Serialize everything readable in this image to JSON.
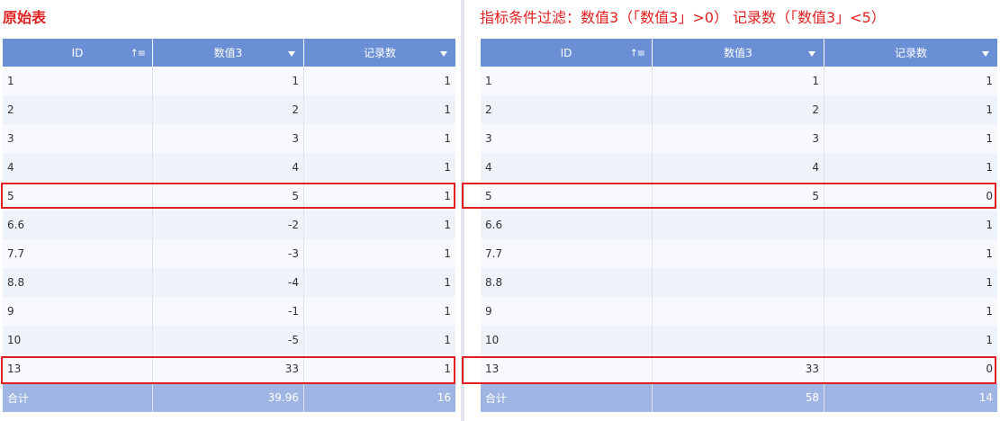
{
  "left": {
    "title": "原始表",
    "headers": [
      "ID",
      "数值3",
      "记录数"
    ],
    "rows": [
      [
        "1",
        "1",
        "1"
      ],
      [
        "2",
        "2",
        "1"
      ],
      [
        "3",
        "3",
        "1"
      ],
      [
        "4",
        "4",
        "1"
      ],
      [
        "5",
        "5",
        "1"
      ],
      [
        "6.6",
        "-2",
        "1"
      ],
      [
        "7.7",
        "-3",
        "1"
      ],
      [
        "8.8",
        "-4",
        "1"
      ],
      [
        "9",
        "-1",
        "1"
      ],
      [
        "10",
        "-5",
        "1"
      ],
      [
        "13",
        "33",
        "1"
      ]
    ],
    "total": [
      "合计",
      "39.96",
      "16"
    ]
  },
  "right": {
    "title": "指标条件过滤：数值3（「数值3」>0） 记录数（「数值3」<5）",
    "headers": [
      "ID",
      "数值3",
      "记录数"
    ],
    "rows": [
      [
        "1",
        "1",
        "1"
      ],
      [
        "2",
        "2",
        "1"
      ],
      [
        "3",
        "3",
        "1"
      ],
      [
        "4",
        "4",
        "1"
      ],
      [
        "5",
        "5",
        "0"
      ],
      [
        "6.6",
        "",
        "1"
      ],
      [
        "7.7",
        "",
        "1"
      ],
      [
        "8.8",
        "",
        "1"
      ],
      [
        "9",
        "",
        "1"
      ],
      [
        "10",
        "",
        "1"
      ],
      [
        "13",
        "33",
        "0"
      ]
    ],
    "total": [
      "合计",
      "58",
      "14"
    ]
  },
  "icons": {
    "id_sort": "sort-ascending-icon",
    "column_menu": "dropdown-caret-icon"
  },
  "colors": {
    "header_bg": "#6b8fd4",
    "total_bg": "#9fb5e3",
    "highlight": "#e02020",
    "row_odd": "#f7f9fc",
    "row_even": "#eef2f9"
  }
}
